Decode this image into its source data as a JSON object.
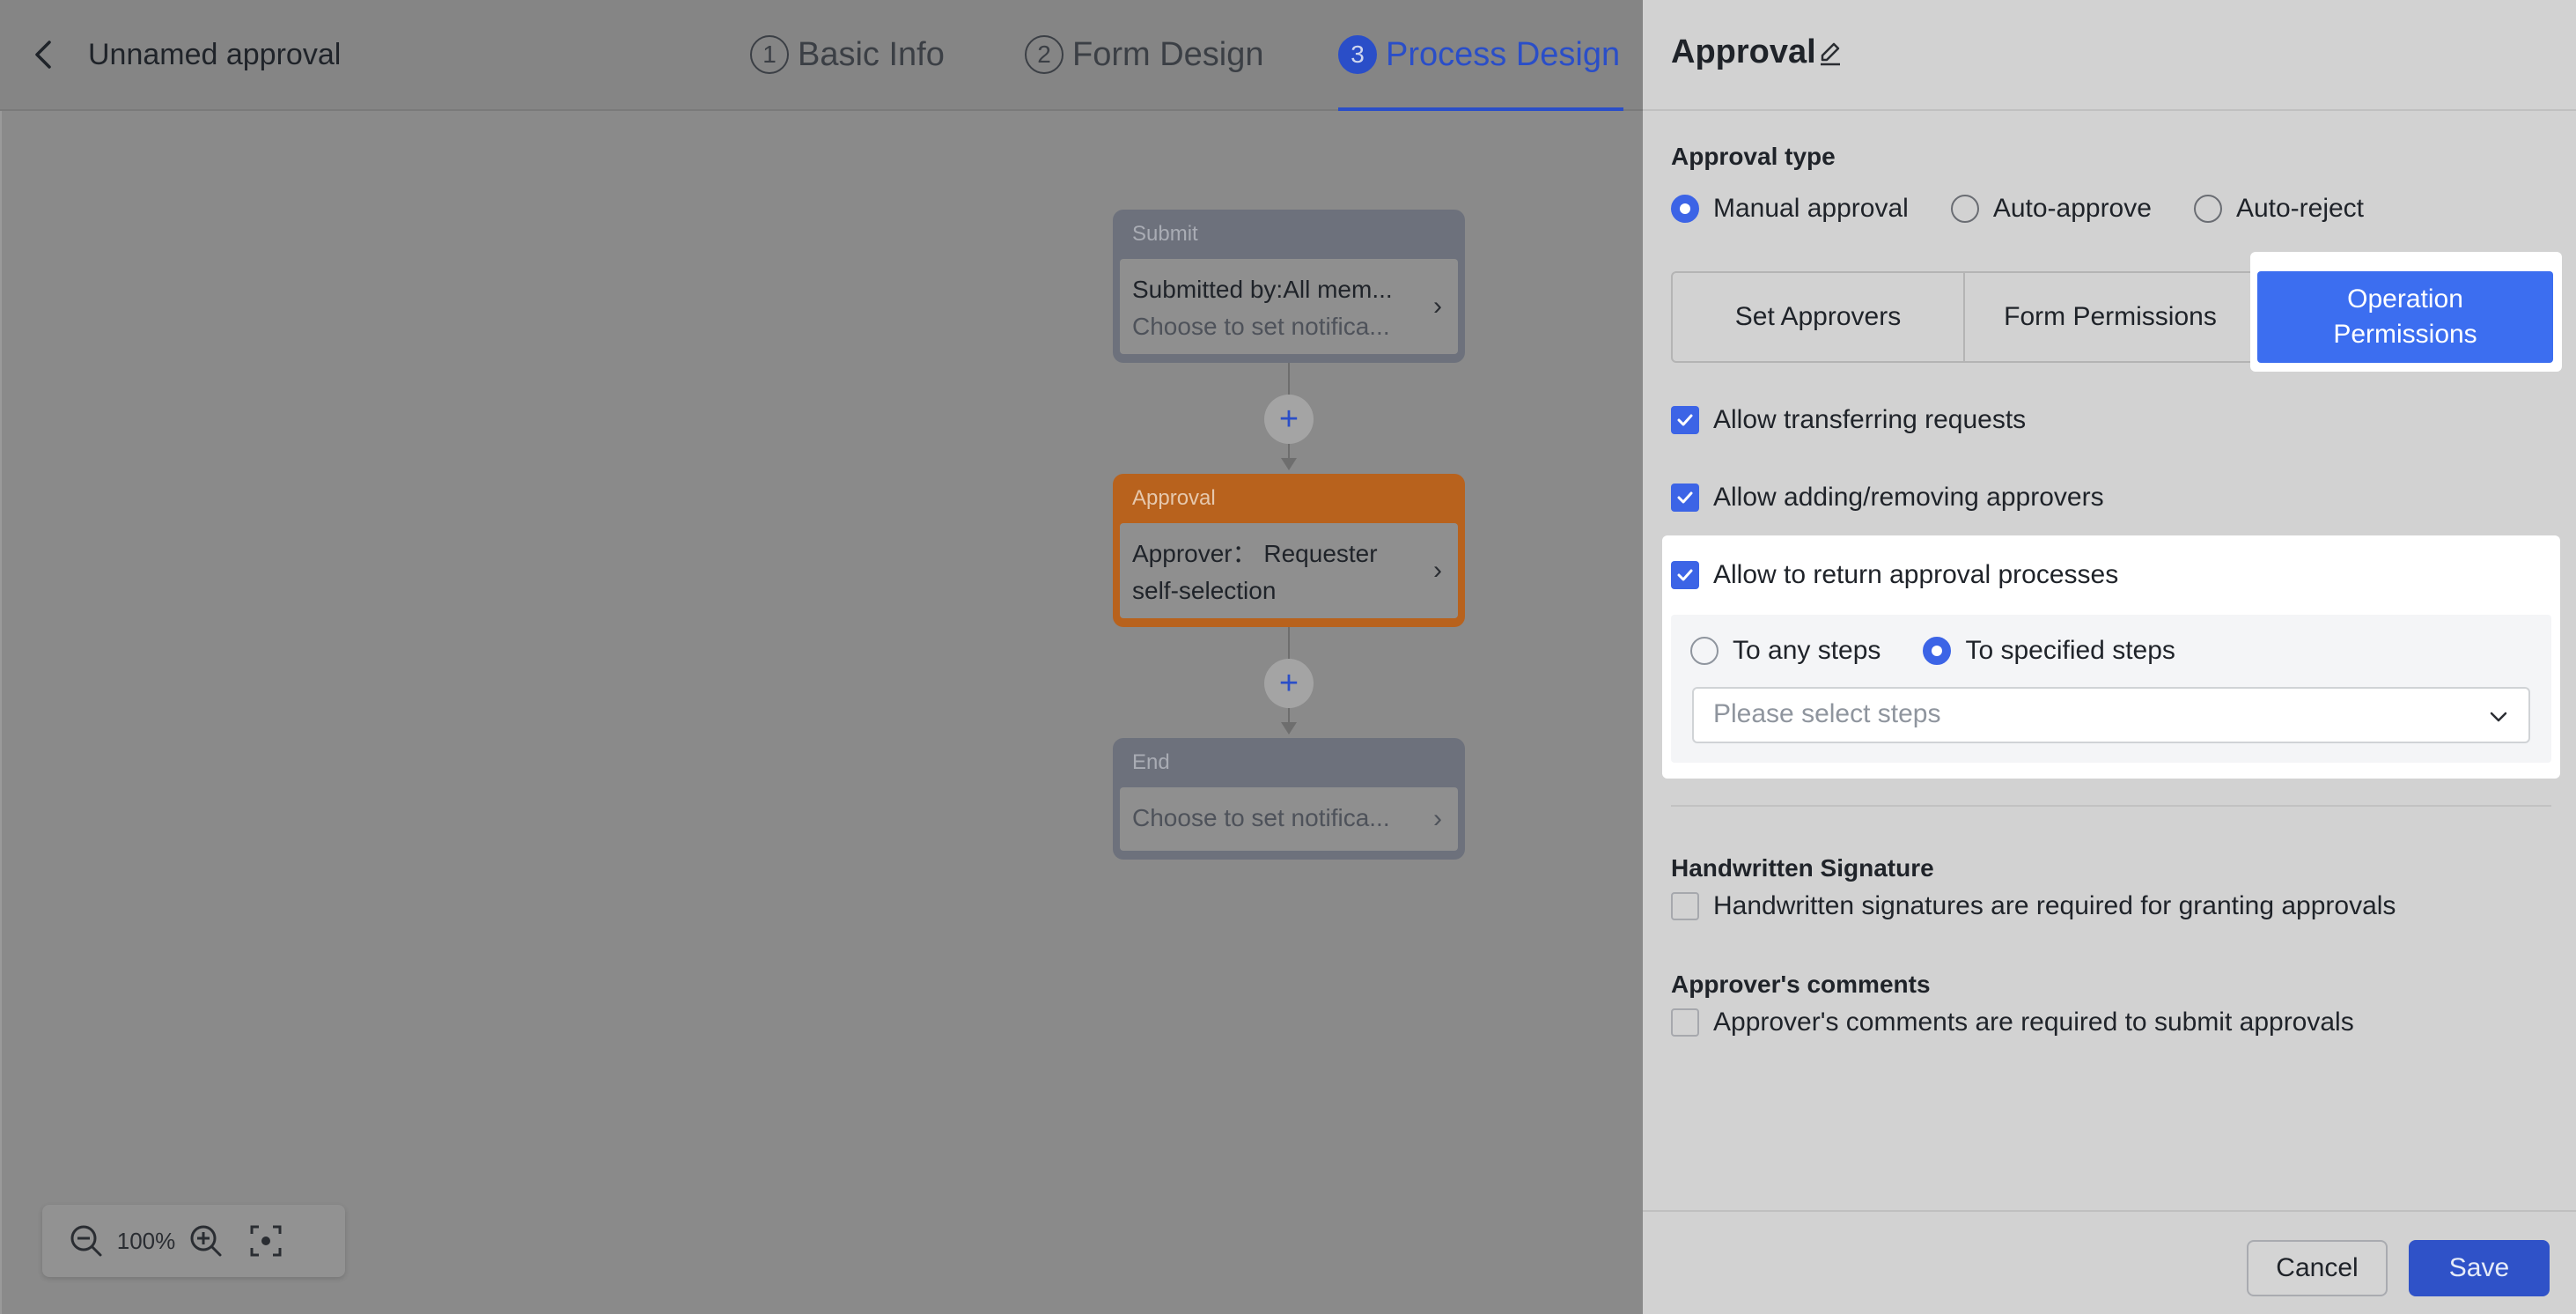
{
  "header": {
    "title": "Unnamed approval",
    "steps": [
      {
        "num": "1",
        "label": "Basic Info"
      },
      {
        "num": "2",
        "label": "Form Design"
      },
      {
        "num": "3",
        "label": "Process Design"
      }
    ]
  },
  "flow": {
    "submit": {
      "title": "Submit",
      "line1": "Submitted by:All mem...",
      "line2": "Choose to set notifica..."
    },
    "approval": {
      "title": "Approval",
      "line1": "Approver： Requester",
      "line2": "self-selection"
    },
    "end": {
      "title": "End",
      "line1": "Choose to set notifica..."
    },
    "add_symbol": "+"
  },
  "zoom": {
    "level": "100%"
  },
  "panel": {
    "title": "Approval",
    "approval_type_label": "Approval type",
    "approval_types": [
      "Manual approval",
      "Auto-approve",
      "Auto-reject"
    ],
    "selected_approval_type": "Manual approval",
    "tabs": [
      "Set Approvers",
      "Form Permissions",
      "Operation Permissions"
    ],
    "active_tab": "Operation Permissions",
    "options": {
      "transfer": "Allow transferring requests",
      "add_remove": "Allow adding/removing approvers",
      "return": "Allow to return approval processes"
    },
    "return_scope": [
      "To any steps",
      "To specified steps"
    ],
    "selected_return_scope": "To specified steps",
    "steps_placeholder": "Please select steps",
    "handwritten": {
      "label": "Handwritten Signature",
      "option": "Handwritten signatures are required for granting approvals"
    },
    "comments": {
      "label": "Approver's comments",
      "option": "Approver's comments are required to submit approvals"
    }
  },
  "footer": {
    "cancel": "Cancel",
    "save": "Save"
  },
  "colors": {
    "accent": "#3c64e6",
    "active_tab": "#3c6ef0",
    "approval_node": "#b8621d"
  }
}
